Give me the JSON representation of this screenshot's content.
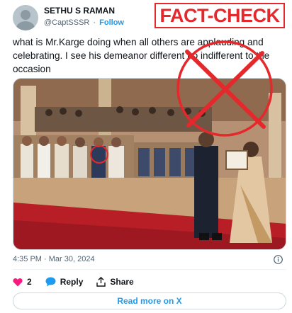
{
  "author": {
    "name": "SETHU S RAMAN",
    "handle": "@CaptSSSR",
    "separator": "·",
    "follow_label": "Follow"
  },
  "stamp": {
    "text": "FACT-CHECK",
    "color": "#e5282c"
  },
  "tweet": {
    "text": "what is Mr.Karge doing when all others are applauding and celebrating. I see his demeanor different no indifferent to the occasion"
  },
  "meta": {
    "timestamp": "4:35 PM · Mar 30, 2024"
  },
  "actions": {
    "like_count": "2",
    "reply_label": "Reply",
    "share_label": "Share"
  },
  "read_more_label": "Read more on X",
  "colors": {
    "accent": "#1d9bf0",
    "like": "#f91880",
    "text": "#0f1419",
    "muted": "#536471"
  },
  "icons": [
    "heart-icon",
    "reply-bubble-icon",
    "share-icon",
    "info-icon",
    "cross-out-mark"
  ]
}
